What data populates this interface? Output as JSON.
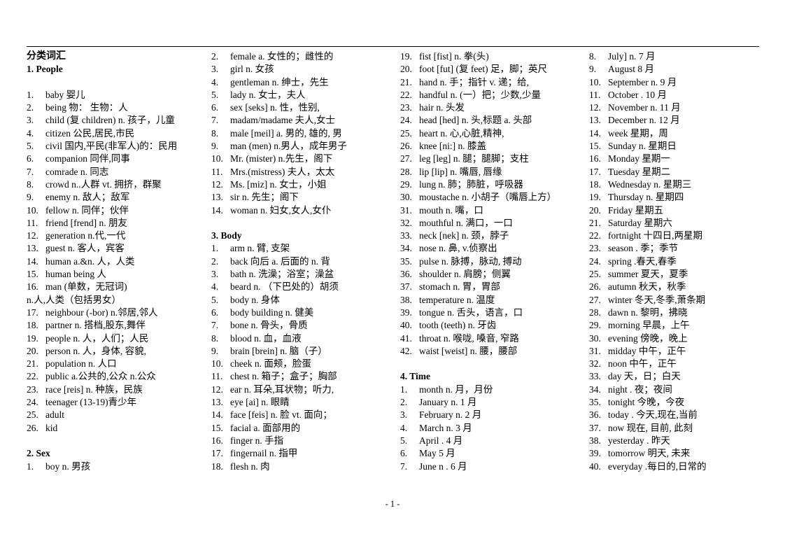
{
  "document": {
    "title": "分类词汇",
    "page_number": "- 1 -"
  },
  "columns": [
    {
      "id": "column-1",
      "blocks": [
        {
          "type": "doc-title",
          "text": "分类词汇"
        },
        {
          "type": "section",
          "text": "1. People"
        },
        {
          "type": "blank"
        },
        {
          "type": "entry",
          "num": "1.",
          "text": "baby   婴儿"
        },
        {
          "type": "entry",
          "num": "2.",
          "text": "being  物：  生物：人"
        },
        {
          "type": "entry",
          "num": "3.",
          "text": "child (复 children) n. 孩子，儿童"
        },
        {
          "type": "entry",
          "num": "4.",
          "text": "citizen    公民,居民,市民"
        },
        {
          "type": "entry",
          "num": "5.",
          "text": "civil  国内,平民(非军人)的：民用"
        },
        {
          "type": "entry",
          "num": "6.",
          "text": "companion  同伴,同事"
        },
        {
          "type": "entry",
          "num": "7.",
          "text": "comrade   n. 同志"
        },
        {
          "type": "entry",
          "num": "8.",
          "text": "crowd n..人群  vt. 拥挤，群聚"
        },
        {
          "type": "entry",
          "num": "9.",
          "text": "enemy    n. 敌人；敌军"
        },
        {
          "type": "entry",
          "num": "10.",
          "text": "fellow    n. 同伴；伙伴"
        },
        {
          "type": "entry",
          "num": "11.",
          "text": "friend [frend] n.  朋友"
        },
        {
          "type": "entry",
          "num": "12.",
          "text": "generation    n.代,一代"
        },
        {
          "type": "entry",
          "num": "13.",
          "text": "guest    n. 客人，宾客"
        },
        {
          "type": "entry",
          "num": "14.",
          "text": "human    a.&n.  人，人类"
        },
        {
          "type": "entry",
          "num": "15.",
          "text": "human being  人"
        },
        {
          "type": "entry",
          "num": "16.",
          "text": "man    (单数，无冠词)"
        },
        {
          "type": "cont",
          "text": "n.人,人类（包括男女）"
        },
        {
          "type": "entry",
          "num": "17.",
          "text": "neighbour (-bor) n.邻居,邻人"
        },
        {
          "type": "entry",
          "num": "18.",
          "text": "partner    n. 搭档,股东,舞伴"
        },
        {
          "type": "entry",
          "num": "19.",
          "text": "people   n. 人，人们；人民"
        },
        {
          "type": "entry",
          "num": "20.",
          "text": "person n.  人，身体, 容貌,"
        },
        {
          "type": "entry",
          "num": "21.",
          "text": "population    n. 人口"
        },
        {
          "type": "entry",
          "num": "22.",
          "text": "public a.公共的,公众 n.公众"
        },
        {
          "type": "entry",
          "num": "23.",
          "text": "race [reis] n.  种族，民族"
        },
        {
          "type": "entry",
          "num": "24.",
          "text": "teenager     (13-19)青少年"
        },
        {
          "type": "entry",
          "num": "25.",
          "text": "adult"
        },
        {
          "type": "entry",
          "num": "26.",
          "text": "kid"
        },
        {
          "type": "blank"
        },
        {
          "type": "section",
          "text": "2. Sex"
        },
        {
          "type": "entry",
          "num": "1.",
          "text": "boy n. 男孩"
        }
      ]
    },
    {
      "id": "column-2",
      "blocks": [
        {
          "type": "entry",
          "num": "2.",
          "text": "female   a. 女性的；雌性的"
        },
        {
          "type": "entry",
          "num": "3.",
          "text": "girl   n.  女孩"
        },
        {
          "type": "entry",
          "num": "4.",
          "text": "gentleman n. 绅士，先生"
        },
        {
          "type": "entry",
          "num": "5.",
          "text": "lady n. 女士，夫人"
        },
        {
          "type": "entry",
          "num": "6.",
          "text": "sex [seks] n. 性，性别,"
        },
        {
          "type": "entry",
          "num": "7.",
          "text": "madam/madame 夫人,女士"
        },
        {
          "type": "entry",
          "num": "8.",
          "text": "male [meil] a. 男的, 雄的, 男"
        },
        {
          "type": "entry",
          "num": "9.",
          "text": "man    (men) n.男人，成年男子"
        },
        {
          "type": "entry",
          "num": "10.",
          "text": "Mr.    (mister) n.先生，阁下"
        },
        {
          "type": "entry",
          "num": "11.",
          "text": "Mrs.(mistress)  夫人，太太"
        },
        {
          "type": "entry",
          "num": "12.",
          "text": "Ms. [miz] n.  女士，小姐"
        },
        {
          "type": "entry",
          "num": "13.",
          "text": "sir n.  先生；阁下"
        },
        {
          "type": "entry",
          "num": "14.",
          "text": "woman    n.  妇女,女人,女仆"
        },
        {
          "type": "blank"
        },
        {
          "type": "section",
          "text": "3. Body"
        },
        {
          "type": "entry",
          "num": "1.",
          "text": "arm    n. 臂, 支架"
        },
        {
          "type": "entry",
          "num": "2.",
          "text": "back    向后 a. 后面的 n. 背"
        },
        {
          "type": "entry",
          "num": "3.",
          "text": "bath    n. 洗澡；浴室；澡盆"
        },
        {
          "type": "entry",
          "num": "4.",
          "text": "beard n.  （下巴处的）胡须"
        },
        {
          "type": "entry",
          "num": "5.",
          "text": "body    n. 身体"
        },
        {
          "type": "entry",
          "num": "6.",
          "text": "body building n. 健美"
        },
        {
          "type": "entry",
          "num": "7.",
          "text": "bone    n. 骨头，骨质"
        },
        {
          "type": "entry",
          "num": "8.",
          "text": "blood    n. 血，血液"
        },
        {
          "type": "entry",
          "num": "9.",
          "text": "brain [brein] n. 脑（子）"
        },
        {
          "type": "entry",
          "num": "10.",
          "text": "cheek n. 面颊，脸蛋"
        },
        {
          "type": "entry",
          "num": "11.",
          "text": "chest n. 箱子；盒子；胸部"
        },
        {
          "type": "entry",
          "num": "12.",
          "text": "ear    n. 耳朵,耳状物；听力,"
        },
        {
          "type": "entry",
          "num": "13.",
          "text": "eye [ai] n. 眼睛"
        },
        {
          "type": "entry",
          "num": "14.",
          "text": "face [feis] n. 脸  vt.  面向；"
        },
        {
          "type": "entry",
          "num": "15.",
          "text": "facial a.  面部用的"
        },
        {
          "type": "entry",
          "num": "16.",
          "text": "finger    n. 手指"
        },
        {
          "type": "entry",
          "num": "17.",
          "text": "fingernail    n. 指甲"
        },
        {
          "type": "entry",
          "num": "18.",
          "text": "flesh    n. 肉"
        }
      ]
    },
    {
      "id": "column-3",
      "blocks": [
        {
          "type": "entry",
          "num": "19.",
          "text": "fist [fist] n.  拳(头)"
        },
        {
          "type": "entry",
          "num": "20.",
          "text": "foot [fut] (复  feet) 足，脚；英尺"
        },
        {
          "type": "entry",
          "num": "21.",
          "text": "hand n.  手；指针 v.  递；给,"
        },
        {
          "type": "entry",
          "num": "22.",
          "text": "handful n. (一）把；少数,少量"
        },
        {
          "type": "entry",
          "num": "23.",
          "text": "hair    n.  头发"
        },
        {
          "type": "entry",
          "num": "24.",
          "text": "head [hed] n.  头,标题  a. 头部"
        },
        {
          "type": "entry",
          "num": "25.",
          "text": "heart    n.  心,心脏,精神,"
        },
        {
          "type": "entry",
          "num": "26.",
          "text": "knee [ni:] n.  膝盖"
        },
        {
          "type": "entry",
          "num": "27.",
          "text": "leg [leg] n.  腿；腿脚；支柱"
        },
        {
          "type": "entry",
          "num": "28.",
          "text": "lip [lip] n.  嘴唇, 唇缘"
        },
        {
          "type": "entry",
          "num": "29.",
          "text": "lung n.  肺；肺脏，呼吸器"
        },
        {
          "type": "entry",
          "num": "30.",
          "text": "moustache n.  小胡子（嘴唇上方）"
        },
        {
          "type": "entry",
          "num": "31.",
          "text": "mouth    n.  嘴，口"
        },
        {
          "type": "entry",
          "num": "32.",
          "text": "mouthful    n.  满口，一口"
        },
        {
          "type": "entry",
          "num": "33.",
          "text": "neck [nek] n.  颈，脖子"
        },
        {
          "type": "entry",
          "num": "34.",
          "text": "nose n.  鼻, v.侦察出"
        },
        {
          "type": "entry",
          "num": "35.",
          "text": "pulse    n.  脉搏，脉动, 搏动"
        },
        {
          "type": "entry",
          "num": "36.",
          "text": "shoulder    n.  肩膀；侧翼"
        },
        {
          "type": "entry",
          "num": "37.",
          "text": "stomach    n.  胃，胃部"
        },
        {
          "type": "entry",
          "num": "38.",
          "text": "temperature    n.  温度"
        },
        {
          "type": "entry",
          "num": "39.",
          "text": "tongue n.  舌头，语言，口"
        },
        {
          "type": "entry",
          "num": "40.",
          "text": "tooth (teeth) n.  牙齿"
        },
        {
          "type": "entry",
          "num": "41.",
          "text": "throat    n.  喉咙, 嗓音, 窄路"
        },
        {
          "type": "entry",
          "num": "42.",
          "text": "waist [weist] n.  腰，腰部"
        },
        {
          "type": "blank"
        },
        {
          "type": "section",
          "text": "4. Time"
        },
        {
          "type": "entry",
          "num": "1.",
          "text": "month n.  月，月份"
        },
        {
          "type": "entry",
          "num": "2.",
          "text": "January n. 1 月"
        },
        {
          "type": "entry",
          "num": "3.",
          "text": "February    n. 2 月"
        },
        {
          "type": "entry",
          "num": "4.",
          "text": "March n. 3 月"
        },
        {
          "type": "entry",
          "num": "5.",
          "text": "April     . 4 月"
        },
        {
          "type": "entry",
          "num": "6.",
          "text": "May      5 月"
        },
        {
          "type": "entry",
          "num": "7.",
          "text": "June     n . 6 月"
        }
      ]
    },
    {
      "id": "column-4",
      "blocks": [
        {
          "type": "entry",
          "num": "8.",
          "text": "July] n. 7 月"
        },
        {
          "type": "entry",
          "num": "9.",
          "text": "August           8 月"
        },
        {
          "type": "entry",
          "num": "10.",
          "text": "September n. 9 月"
        },
        {
          "type": "entry",
          "num": "11.",
          "text": "October     . 10 月"
        },
        {
          "type": "entry",
          "num": "12.",
          "text": "November    n. 11 月"
        },
        {
          "type": "entry",
          "num": "13.",
          "text": "December n. 12 月"
        },
        {
          "type": "entry",
          "num": "14.",
          "text": "week        星期，周"
        },
        {
          "type": "entry",
          "num": "15.",
          "text": "Sunday   n. 星期日"
        },
        {
          "type": "entry",
          "num": "16.",
          "text": "Monday           星期一"
        },
        {
          "type": "entry",
          "num": "17.",
          "text": "Tuesday             星期二"
        },
        {
          "type": "entry",
          "num": "18.",
          "text": "Wednesday n. 星期三"
        },
        {
          "type": "entry",
          "num": "19.",
          "text": "Thursday n. 星期四"
        },
        {
          "type": "entry",
          "num": "20.",
          "text": "Friday     星期五"
        },
        {
          "type": "entry",
          "num": "21.",
          "text": "Saturday           星期六"
        },
        {
          "type": "entry",
          "num": "22.",
          "text": "fortnight     十四日,两星期"
        },
        {
          "type": "entry",
          "num": "23.",
          "text": "season      . 季；季节"
        },
        {
          "type": "entry",
          "num": "24.",
          "text": "spring       .春天,春季"
        },
        {
          "type": "entry",
          "num": "25.",
          "text": "summer       夏天，夏季"
        },
        {
          "type": "entry",
          "num": "26.",
          "text": "autumn       秋天，秋季"
        },
        {
          "type": "entry",
          "num": "27.",
          "text": "winter     冬天,冬季,萧条期"
        },
        {
          "type": "entry",
          "num": "28.",
          "text": "dawn n.  黎明，拂晓"
        },
        {
          "type": "entry",
          "num": "29.",
          "text": "morning       早晨，上午"
        },
        {
          "type": "entry",
          "num": "30.",
          "text": "evening       傍晚，晚上"
        },
        {
          "type": "entry",
          "num": "31.",
          "text": "midday     中午，正午"
        },
        {
          "type": "entry",
          "num": "32.",
          "text": "noon     中午，正午"
        },
        {
          "type": "entry",
          "num": "33.",
          "text": "day          天，日；白天"
        },
        {
          "type": "entry",
          "num": "34.",
          "text": "night      . 夜；夜间"
        },
        {
          "type": "entry",
          "num": "35.",
          "text": "tonight     今晚，今夜"
        },
        {
          "type": "entry",
          "num": "36.",
          "text": "today .   今天,现在,当前"
        },
        {
          "type": "entry",
          "num": "37.",
          "text": "now       现在, 目前, 此刻"
        },
        {
          "type": "entry",
          "num": "38.",
          "text": "yesterday . 昨天"
        },
        {
          "type": "entry",
          "num": "39.",
          "text": "tomorrow  明天, 未来"
        },
        {
          "type": "entry",
          "num": "40.",
          "text": "everyday .每日的,日常的"
        }
      ]
    }
  ]
}
